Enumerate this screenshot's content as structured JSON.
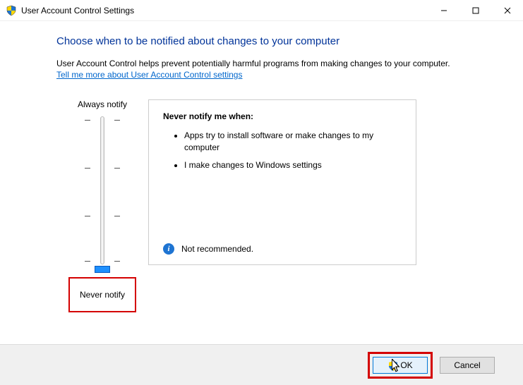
{
  "window": {
    "title": "User Account Control Settings",
    "minimize": "—",
    "maximize": "☐",
    "close": "✕"
  },
  "heading": "Choose when to be notified about changes to your computer",
  "description": "User Account Control helps prevent potentially harmful programs from making changes to your computer.",
  "link_text": "Tell me more about User Account Control settings",
  "slider": {
    "top_label": "Always notify",
    "bottom_label": "Never notify"
  },
  "detail": {
    "title": "Never notify me when:",
    "items": [
      "Apps try to install software or make changes to my computer",
      "I make changes to Windows settings"
    ],
    "recommend": "Not recommended."
  },
  "buttons": {
    "ok": "OK",
    "cancel": "Cancel"
  }
}
